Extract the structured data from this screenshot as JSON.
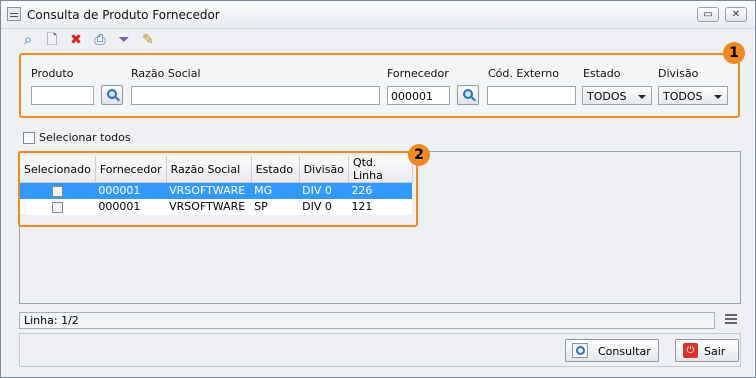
{
  "window": {
    "title": "Consulta de Produto Fornecedor"
  },
  "toolbar": {
    "icons": [
      "search-icon",
      "new-document-icon",
      "delete-icon",
      "print-icon",
      "filter-icon",
      "edit-icon"
    ]
  },
  "filters": {
    "badge": "1",
    "produto_label": "Produto",
    "produto_value": "",
    "razao_social_label": "Razão Social",
    "razao_social_value": "",
    "fornecedor_label": "Fornecedor",
    "fornecedor_value": "000001",
    "cod_externo_label": "Cód. Externo",
    "cod_externo_value": "",
    "estado_label": "Estado",
    "estado_value": "TODOS",
    "divisao_label": "Divisão",
    "divisao_value": "TODOS"
  },
  "selecionar_todos_label": "Selecionar todos",
  "grid": {
    "badge": "2",
    "columns": [
      "Selecionado",
      "Fornecedor",
      "Razão Social",
      "Estado",
      "Divisão",
      "Qtd. Linha"
    ],
    "rows": [
      {
        "fornecedor": "000001",
        "razao_social": "VRSOFTWARE",
        "estado": "MG",
        "divisao": "DIV 0",
        "qtd_linha": "226"
      },
      {
        "fornecedor": "000001",
        "razao_social": "VRSOFTWARE",
        "estado": "SP",
        "divisao": "DIV 0",
        "qtd_linha": "121"
      }
    ]
  },
  "status": {
    "text": "Linha: 1/2"
  },
  "buttons": {
    "consultar": "Consultar",
    "sair": "Sair"
  },
  "colors": {
    "accent": "#f08a24",
    "selection": "#3399ff"
  }
}
